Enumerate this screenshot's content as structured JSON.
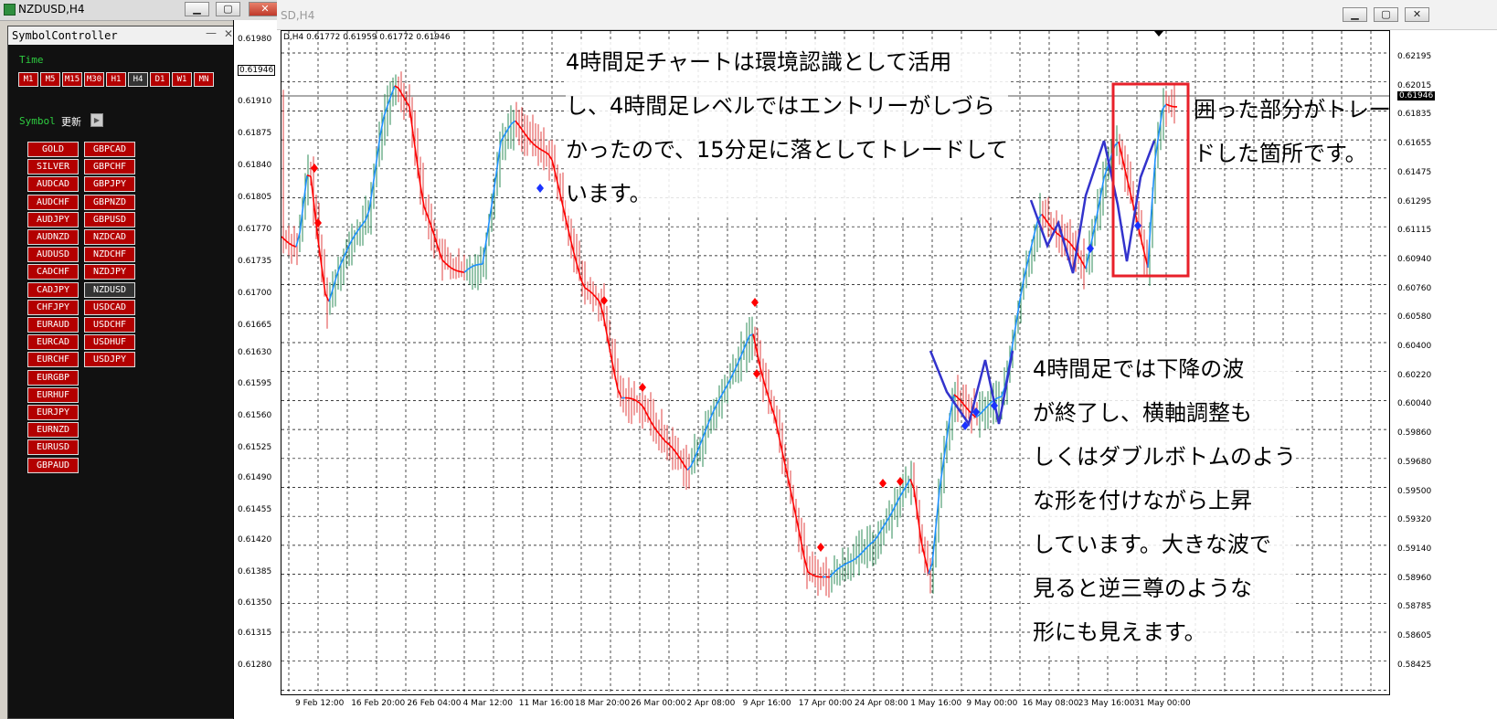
{
  "left_window": {
    "title": "NZDUSD,H4",
    "minimize": "▁",
    "restore": "▢",
    "close": "✕"
  },
  "symbol_controller": {
    "title": "SymbolController",
    "minimize": "—",
    "close": "✕",
    "time_label": "Time",
    "timeframes": [
      "M1",
      "M5",
      "M15",
      "M30",
      "H1",
      "H4",
      "D1",
      "W1",
      "MN"
    ],
    "selected_timeframe": "H4",
    "symbol_label": "Symbol",
    "refresh_label": "更新",
    "refresh_button": "▶",
    "symbols_col1": [
      "GOLD",
      "SILVER",
      "AUDCAD",
      "AUDCHF",
      "AUDJPY",
      "AUDNZD",
      "AUDUSD",
      "CADCHF",
      "CADJPY",
      "CHFJPY",
      "EURAUD",
      "EURCAD",
      "EURCHF",
      "EURGBP",
      "EURHUF",
      "EURJPY",
      "EURNZD",
      "EURUSD",
      "GBPAUD"
    ],
    "symbols_col2": [
      "GBPCAD",
      "GBPCHF",
      "GBPJPY",
      "GBPNZD",
      "GBPUSD",
      "NZDCAD",
      "NZDCHF",
      "NZDJPY",
      "NZDUSD",
      "USDCAD",
      "USDCHF",
      "USDHUF",
      "USDJPY"
    ],
    "selected_symbol": "NZDUSD"
  },
  "left_scale": {
    "prices": [
      "0.61980",
      "0.61946",
      "0.61910",
      "0.61875",
      "0.61840",
      "0.61805",
      "0.61770",
      "0.61735",
      "0.61700",
      "0.61665",
      "0.61630",
      "0.61595",
      "0.61560",
      "0.61525",
      "0.61490",
      "0.61455",
      "0.61420",
      "0.61385",
      "0.61350",
      "0.61315",
      "0.61280"
    ],
    "current": "0.61946"
  },
  "right_window": {
    "title": "SD,H4",
    "minimize": "▁",
    "restore": "▢",
    "close": "✕",
    "ohlc": "D,H4  0.61772 0.61959 0.61772 0.61946"
  },
  "right_scale": {
    "prices": [
      "0.62195",
      "0.62015",
      "0.61835",
      "0.61655",
      "0.61475",
      "0.61295",
      "0.61115",
      "0.60940",
      "0.60760",
      "0.60580",
      "0.60400",
      "0.60220",
      "0.60040",
      "0.59860",
      "0.59680",
      "0.59500",
      "0.59320",
      "0.59140",
      "0.58960",
      "0.58785",
      "0.58605",
      "0.58425"
    ],
    "current": "0.61946"
  },
  "time_axis": [
    "9 Feb 12:00",
    "16 Feb 20:00",
    "26 Feb 04:00",
    "4 Mar 12:00",
    "11 Mar 16:00",
    "18 Mar 20:00",
    "26 Mar 00:00",
    "2 Apr 08:00",
    "9 Apr 16:00",
    "17 Apr 00:00",
    "24 Apr 08:00",
    "1 May 16:00",
    "9 May 00:00",
    "16 May 08:00",
    "23 May 16:00",
    "31 May 00:00"
  ],
  "annotations": {
    "note1": [
      "4時間足チャートは環境認識として活用",
      "し、4時間足レベルではエントリーがしづら",
      "かったので、15分足に落としてトレードして",
      "います。"
    ],
    "note2": [
      "囲った部分がトレー",
      "ドした箇所です。"
    ],
    "note3": [
      "4時間足では下降の波",
      "が終了し、横軸調整も",
      "しくはダブルボトムのよう",
      "な形を付けながら上昇",
      "しています。大きな波で",
      "見ると逆三尊のような",
      "形にも見えます。"
    ]
  },
  "colors": {
    "up_line": "#1e90ff",
    "down_line": "#ff0000",
    "candle_up": "#2e8b57",
    "candle_down": "#e04040",
    "zigzag": "#3333cc",
    "highlight_box": "#e8202a",
    "button_red": "#b30000"
  }
}
